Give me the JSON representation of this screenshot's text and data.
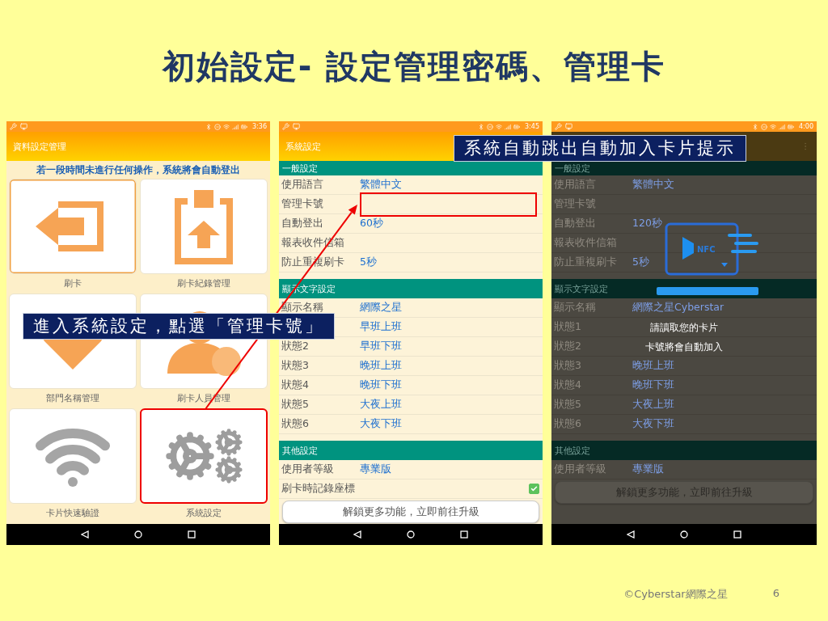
{
  "slide": {
    "title": "初始設定- 設定管理密碼、管理卡"
  },
  "phones": [
    {
      "kind": "menu",
      "time": "3:36",
      "app_title": "資料設定管理",
      "notice": "若一段時間未進行任何操作，系統將會自動登出",
      "tiles": [
        {
          "label": "刷卡",
          "kind": "exit",
          "selected": true,
          "highlighted": false
        },
        {
          "label": "刷卡紀錄管理",
          "kind": "clipboard",
          "selected": false,
          "highlighted": false
        },
        {
          "label": "部門名稱管理",
          "kind": "heart",
          "selected": false,
          "highlighted": false
        },
        {
          "label": "刷卡人員管理",
          "kind": "person",
          "selected": false,
          "highlighted": false
        },
        {
          "label": "卡片快速驗證",
          "kind": "wifi",
          "selected": false,
          "highlighted": false
        },
        {
          "label": "系統設定",
          "kind": "gears",
          "selected": false,
          "highlighted": true
        }
      ]
    },
    {
      "kind": "settings",
      "dimmed": false,
      "time": "3:45",
      "app_title": "系統設定",
      "menu": false,
      "sections": [
        {
          "title": "一般設定",
          "rows": [
            {
              "kind": "text",
              "label": "使用語言",
              "value": "繁體中文",
              "highlighted": false
            },
            {
              "kind": "text",
              "label": "管理卡號",
              "highlighted": true
            },
            {
              "kind": "text",
              "label": "自動登出",
              "value": "60秒",
              "highlighted": false
            },
            {
              "kind": "text",
              "label": "報表收件信箱",
              "highlighted": false
            },
            {
              "kind": "text",
              "label": "防止重複刷卡",
              "value": "5秒",
              "highlighted": false
            }
          ]
        },
        {
          "title": "顯示文字設定",
          "rows": [
            {
              "kind": "text",
              "label": "顯示名稱",
              "value": "網際之星",
              "highlighted": false
            },
            {
              "kind": "text",
              "value": "早班上班",
              "highlighted": false
            },
            {
              "kind": "text",
              "label": "狀態2",
              "value": "早班下班",
              "highlighted": false
            },
            {
              "kind": "text",
              "label": "狀態3",
              "value": "晚班上班",
              "highlighted": false
            },
            {
              "kind": "text",
              "label": "狀態4",
              "value": "晚班下班",
              "highlighted": false
            },
            {
              "kind": "text",
              "label": "狀態5",
              "value": "大夜上班",
              "highlighted": false
            },
            {
              "kind": "text",
              "label": "狀態6",
              "value": "大夜下班",
              "highlighted": false
            }
          ]
        },
        {
          "title": "其他設定",
          "rows": [
            {
              "kind": "text",
              "label": "使用者等級",
              "value": "專業版",
              "highlighted": false
            },
            {
              "kind": "checkbox",
              "label": "刷卡時記錄座標",
              "checked": true,
              "highlighted": false
            }
          ]
        }
      ],
      "button": "解鎖更多功能，立即前往升級"
    },
    {
      "kind": "settings",
      "dimmed": true,
      "time": "4:00",
      "menu": true,
      "sections": [
        {
          "title": "一般設定",
          "rows": [
            {
              "kind": "text",
              "label": "使用語言",
              "value": "繁體中文",
              "highlighted": false
            },
            {
              "kind": "text",
              "label": "管理卡號",
              "highlighted": false
            },
            {
              "kind": "text",
              "label": "自動登出",
              "value": "120秒",
              "highlighted": false
            },
            {
              "kind": "text",
              "label": "報表收件信箱",
              "highlighted": false
            },
            {
              "kind": "text",
              "label": "防止重複刷卡",
              "value": "5秒",
              "highlighted": false
            }
          ]
        },
        {
          "title": "顯示文字設定",
          "rows": [
            {
              "kind": "text",
              "label": "顯示名稱",
              "value": "網際之星Cyberstar",
              "highlighted": false
            },
            {
              "kind": "text",
              "label": "狀態1",
              "highlighted": false
            },
            {
              "kind": "text",
              "label": "狀態2",
              "highlighted": false
            },
            {
              "kind": "text",
              "label": "狀態3",
              "value": "晚班上班",
              "highlighted": false
            },
            {
              "kind": "text",
              "label": "狀態4",
              "value": "晚班下班",
              "highlighted": false
            },
            {
              "kind": "text",
              "label": "狀態5",
              "value": "大夜上班",
              "highlighted": false
            },
            {
              "kind": "text",
              "label": "狀態6",
              "value": "大夜下班",
              "highlighted": false
            }
          ]
        },
        {
          "title": "其他設定",
          "rows": [
            {
              "kind": "text",
              "label": "使用者等級",
              "value": "專業版",
              "highlighted": false
            }
          ]
        }
      ],
      "button": "解鎖更多功能，立即前往升級",
      "dialog": {
        "nfc_label": "NFC",
        "lines": [
          "請讀取您的卡片",
          "卡號將會自動加入"
        ]
      }
    }
  ],
  "callouts": [
    {
      "text": "進入系統設定，點選「管理卡號」"
    },
    {
      "text": "系統自動跳出自動加入卡片提示"
    }
  ],
  "footer": {
    "copyright": "©Cyberstar網際之星",
    "page": "6"
  }
}
